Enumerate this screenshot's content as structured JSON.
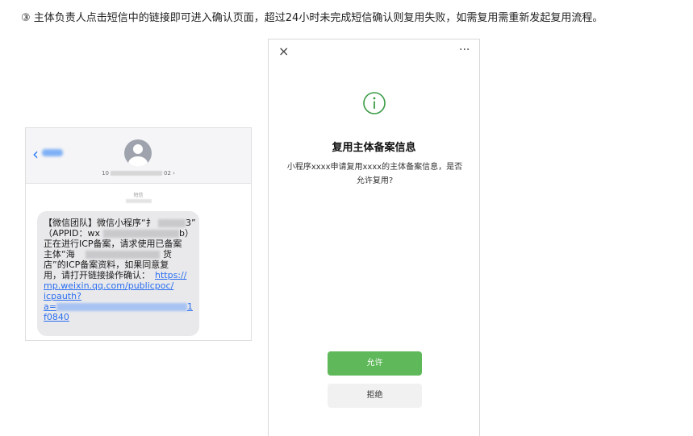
{
  "instruction": "③ 主体负责人点击短信中的链接即可进入确认页面，超过24小时未完成短信确认则复用失败，如需复用需重新发起复用流程。",
  "sms": {
    "number_prefix": "10",
    "number_suffix": "02 ›",
    "label": "短信",
    "lines": [
      "【微信团队】微信小程序“扌",
      "3”",
      "（APPID：wx",
      "b）",
      "正在进行ICP备案，请求使用已备案",
      "主体“海",
      "货",
      "店”的ICP备案资料，如果同意复",
      "用，请打开链接操作确认：",
      "https://",
      "mp.weixin.qq.com/publicpoc/",
      "icpauth?",
      "a=",
      "1",
      "f0840"
    ]
  },
  "dialog": {
    "close_glyph": "×",
    "more_glyph": "···",
    "title": "复用主体备案信息",
    "body": "小程序xxxx申请复用xxxx的主体备案信息，是否允许复用?",
    "allow_label": "允许",
    "deny_label": "拒绝",
    "colors": {
      "accent": "#5fb95a",
      "info_icon": "#3a9b45"
    }
  }
}
